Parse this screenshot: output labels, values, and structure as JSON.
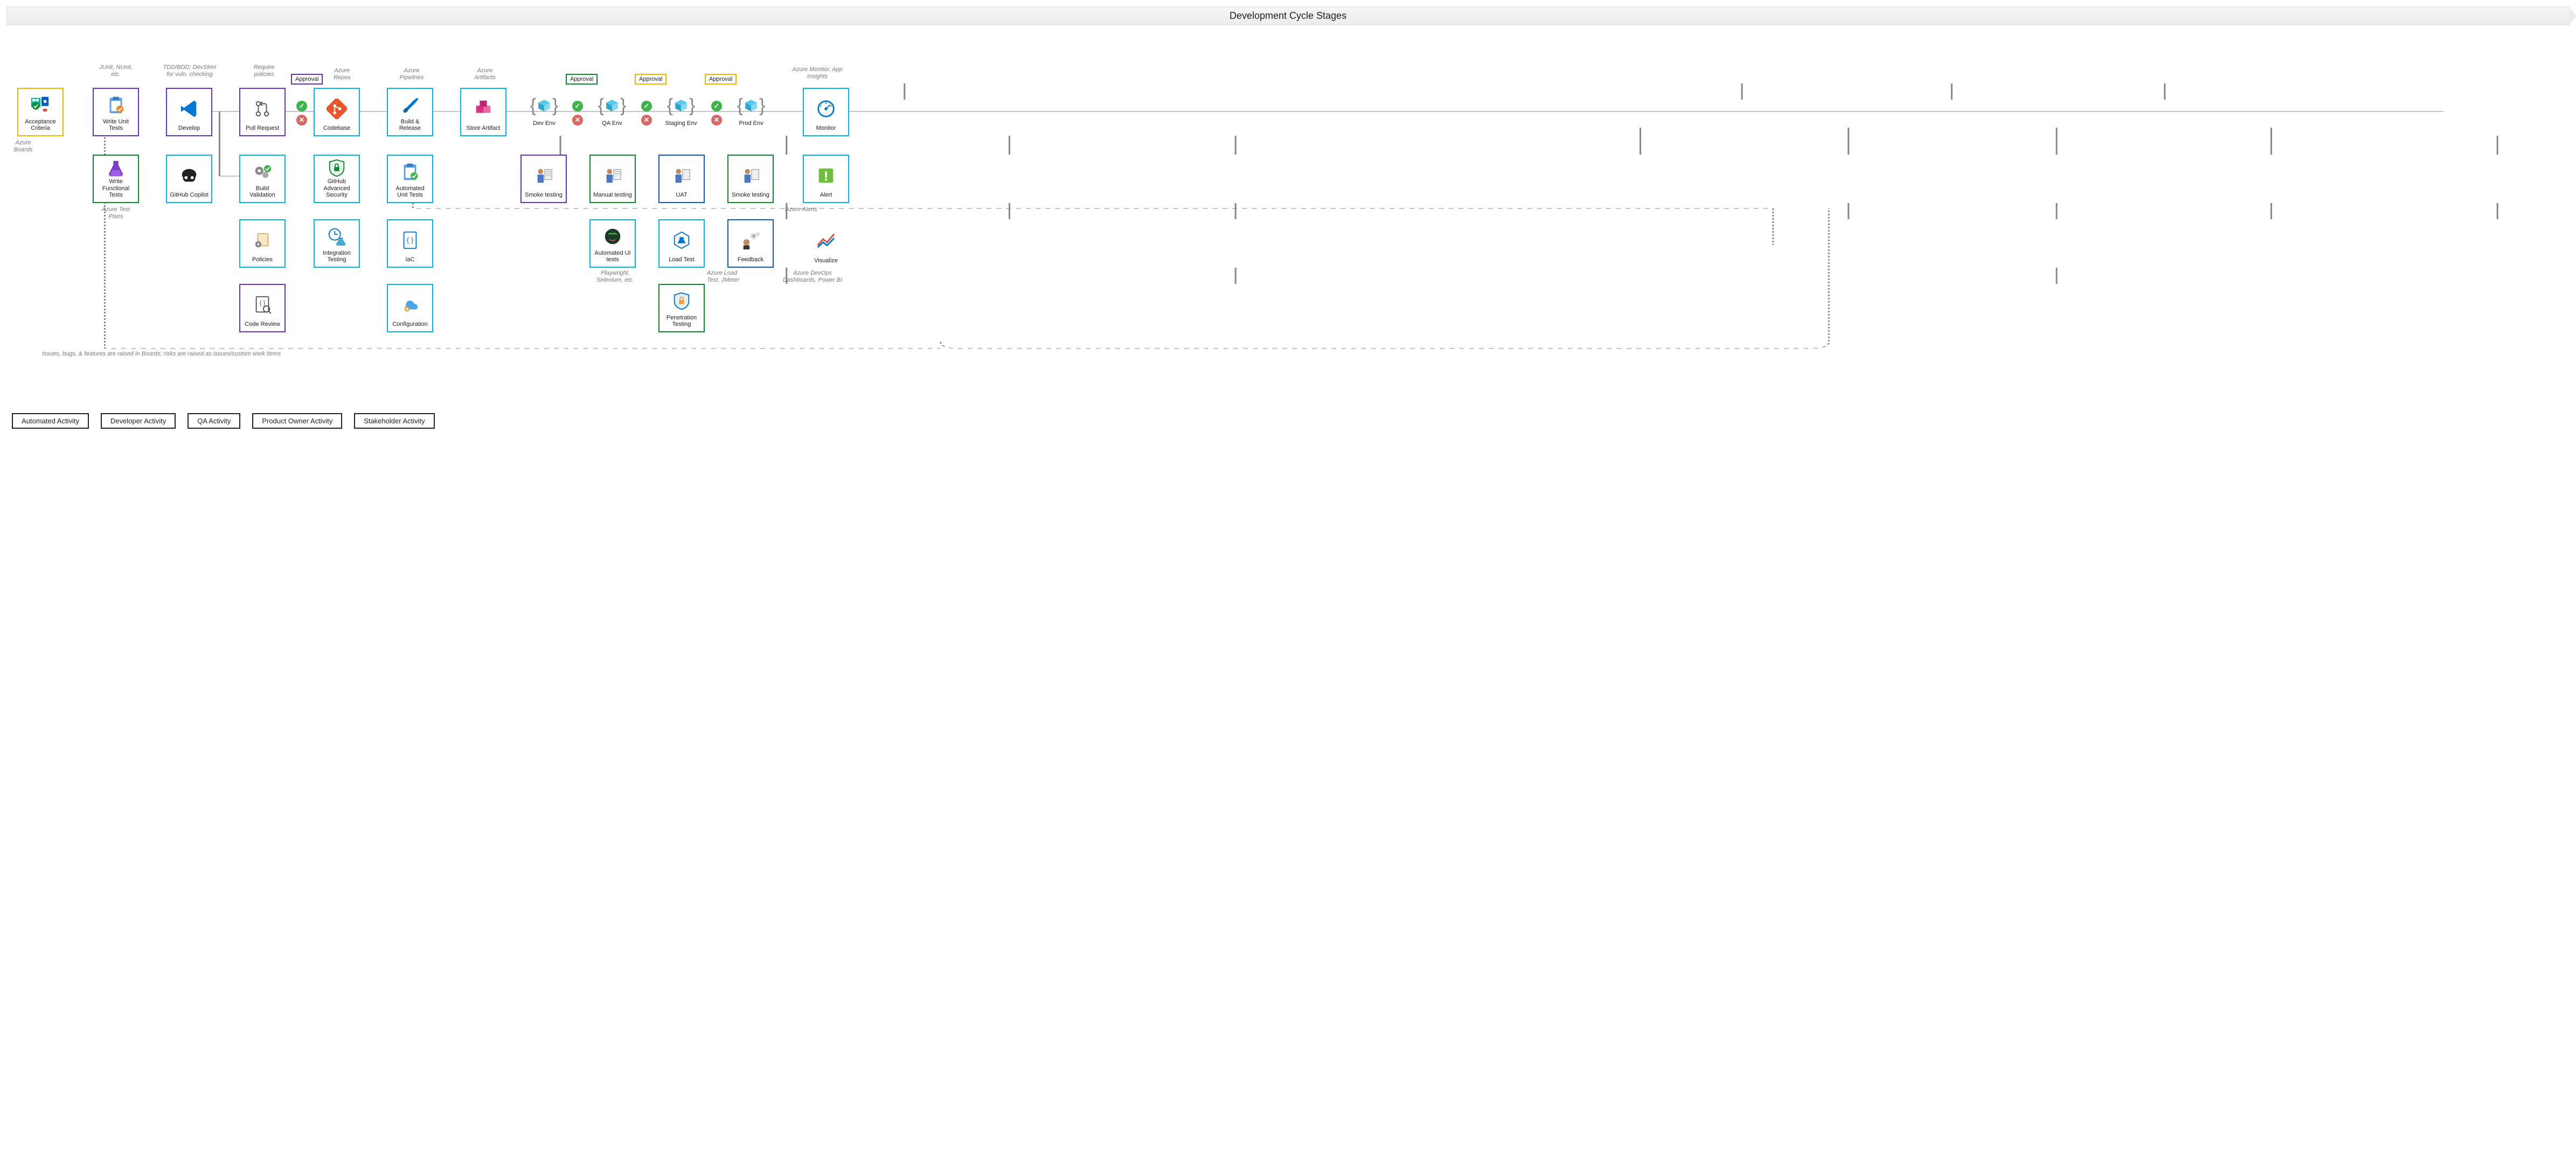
{
  "title": "Development Cycle Stages",
  "legend": {
    "automated": "Automated Activity",
    "developer": "Developer Activity",
    "qa": "QA Activity",
    "po": "Product Owner Activity",
    "stakeholder": "Stakeholder Activity"
  },
  "approvals": {
    "codebase": "Approval",
    "qa": "Approval",
    "staging": "Approval",
    "prod": "Approval"
  },
  "nodes": {
    "acceptance": "Acceptance Criteria",
    "unit_tests": "Write Unit Tests",
    "func_tests": "Write Functional Tests",
    "develop": "Develop",
    "copilot": "GitHub Copilot",
    "pr": "Pull Request",
    "build_valid": "Build Validation",
    "policies": "Policies",
    "code_review": "Code Review",
    "codebase": "Codebase",
    "ghas": "GitHub Advanced Security",
    "int_test": "Integration Testing",
    "build_rel": "Build & Release",
    "auto_unit": "Automated Unit Tests",
    "iac": "IaC",
    "config": "Configuration",
    "artifact": "Store Artifact",
    "dev_env": "Dev Env",
    "smoke_dev": "Smoke testing",
    "qa_env": "QA Env",
    "manual": "Manual testing",
    "auto_ui": "Automated UI tests",
    "staging_env": "Staging Env",
    "uat": "UAT",
    "load": "Load Test",
    "pen": "Penetration Testing",
    "prod_env": "Prod Env",
    "smoke_prod": "Smoke testing",
    "feedback": "Feedback",
    "monitor": "Monitor",
    "alert": "Alert",
    "visualize": "Visualize"
  },
  "annotations": {
    "azure_boards": "Azure Boards",
    "junit": "JUnit, NUnit, etc.",
    "tdd": "TDD/BDD; DevSkim for vuln. checking",
    "require_policies": "Require policies",
    "azure_repos": "Azure Repos",
    "azure_pipelines": "Azure Pipelines",
    "azure_artifacts": "Azure Artifacts",
    "test_plans": "Azure Test Plans",
    "playwright": "Playwright, Selenium, etc.",
    "load_test": "Azure Load Test, JMeter",
    "azure_alerts": "Azure Alerts",
    "monitor_tools": "Azure Monitor, App Insights",
    "dashboards": "Azure DevOps Dashboards, Power BI",
    "feedback_loop": "Issues, bugs, & features are raised in Boards; risks are raised as issues/custom work items"
  }
}
